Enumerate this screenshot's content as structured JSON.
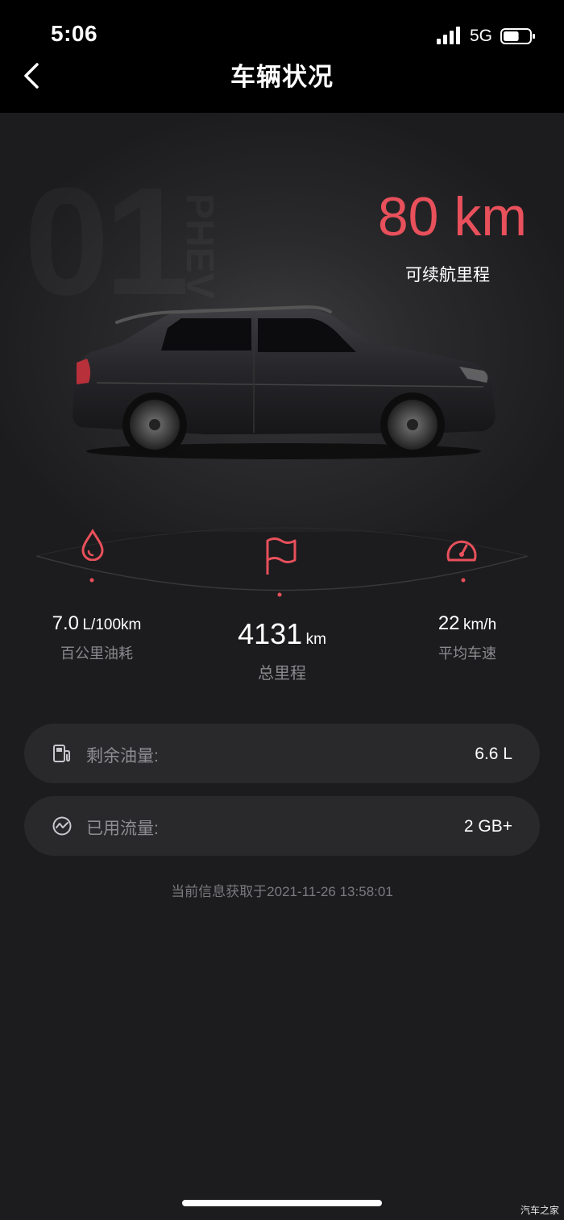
{
  "status_bar": {
    "time": "5:06",
    "network": "5G",
    "battery_level": 0.6
  },
  "nav": {
    "title": "车辆状况"
  },
  "hero": {
    "watermark": "01",
    "watermark_sub": "PHEV",
    "range_value": "80 km",
    "range_label": "可续航里程"
  },
  "stats": {
    "fuel": {
      "value": "7.0",
      "unit": "L/100km",
      "label": "百公里油耗"
    },
    "mileage": {
      "value": "4131",
      "unit": "km",
      "label": "总里程"
    },
    "speed": {
      "value": "22",
      "unit": "km/h",
      "label": "平均车速"
    }
  },
  "cards": [
    {
      "label": "剩余油量:",
      "value": "6.6 L",
      "icon": "fuel-pump-icon"
    },
    {
      "label": "已用流量:",
      "value": "2 GB+",
      "icon": "data-usage-icon"
    }
  ],
  "updated_text": "当前信息获取于2021-11-26 13:58:01",
  "watermark_corner": "汽车之家",
  "colors": {
    "accent": "#e8505b",
    "background": "#1c1c1e",
    "card": "#29292c"
  }
}
